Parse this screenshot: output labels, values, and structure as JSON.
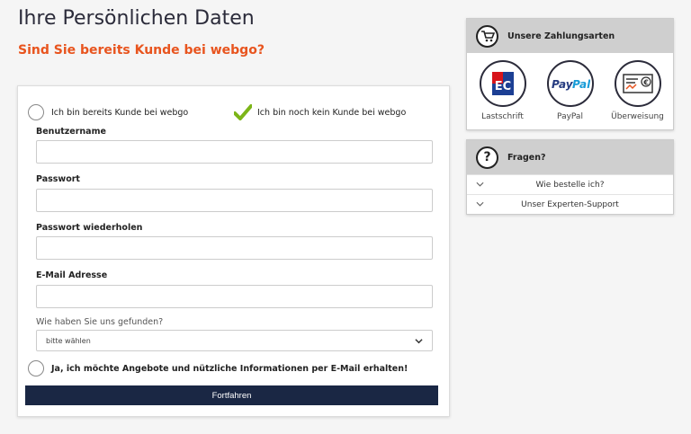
{
  "page": {
    "title": "Ihre Persönlichen Daten",
    "subtitle": "Sind Sie bereits Kunde bei webgo?"
  },
  "customer_choice": {
    "existing_label": "Ich bin bereits Kunde bei webgo",
    "new_label": "Ich bin noch kein Kunde bei webgo",
    "selected": "new"
  },
  "form": {
    "username_label": "Benutzername",
    "password_label": "Passwort",
    "password_repeat_label": "Passwort wiederholen",
    "email_label": "E-Mail Adresse",
    "found_label": "Wie haben Sie uns gefunden?",
    "found_selected": "bitte wählen",
    "newsletter_label": "Ja, ich möchte Angebote und nützliche Informationen per E-Mail erhalten!",
    "submit_label": "Fortfahren"
  },
  "payment_box": {
    "title": "Unsere Zahlungsarten",
    "methods": [
      {
        "label": "Lastschrift",
        "icon": "ec-card-icon"
      },
      {
        "label": "PayPal",
        "icon": "paypal-icon"
      },
      {
        "label": "Überweisung",
        "icon": "bank-transfer-icon"
      }
    ]
  },
  "faq_box": {
    "title": "Fragen?",
    "items": [
      {
        "label": "Wie bestelle ich?"
      },
      {
        "label": "Unser Experten-Support"
      }
    ]
  },
  "colors": {
    "accent": "#e8541e",
    "button": "#1a2744",
    "check": "#7cb518"
  }
}
